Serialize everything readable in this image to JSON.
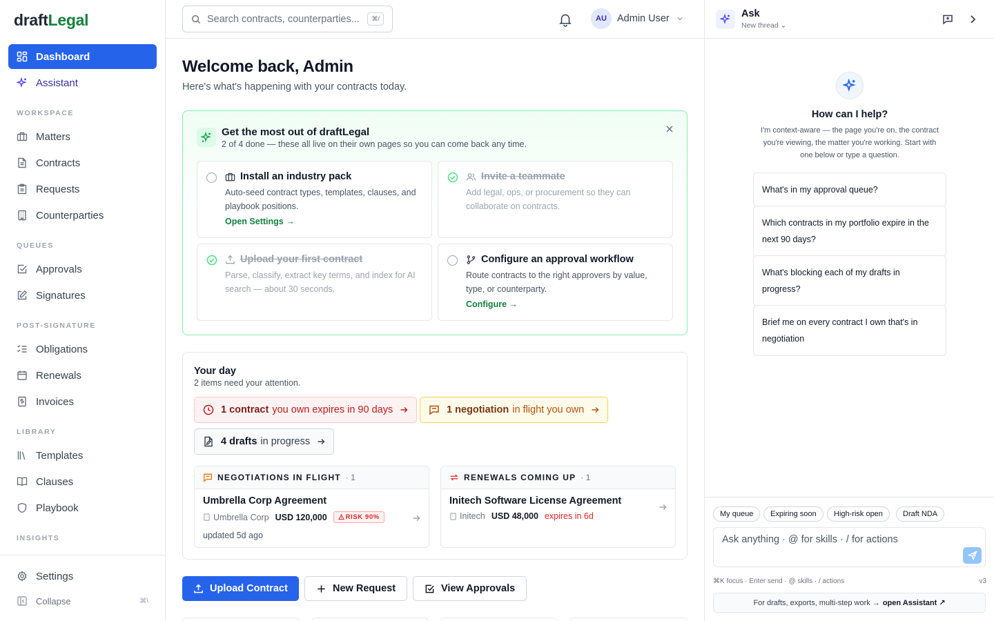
{
  "brand": {
    "part1": "draft",
    "part2": "Legal",
    "accent": "#15803d"
  },
  "sidebar": {
    "top": [
      {
        "label": "Dashboard",
        "icon": "dashboard-icon",
        "active": true
      },
      {
        "label": "Assistant",
        "icon": "sparkle-icon"
      }
    ],
    "sections": [
      {
        "title": "WORKSPACE",
        "items": [
          {
            "label": "Matters",
            "icon": "briefcase-icon"
          },
          {
            "label": "Contracts",
            "icon": "document-icon"
          },
          {
            "label": "Requests",
            "icon": "clipboard-icon"
          },
          {
            "label": "Counterparties",
            "icon": "building-icon"
          }
        ]
      },
      {
        "title": "QUEUES",
        "items": [
          {
            "label": "Approvals",
            "icon": "check-square-icon"
          },
          {
            "label": "Signatures",
            "icon": "pen-square-icon"
          }
        ]
      },
      {
        "title": "POST-SIGNATURE",
        "items": [
          {
            "label": "Obligations",
            "icon": "list-check-icon"
          },
          {
            "label": "Renewals",
            "icon": "calendar-icon"
          },
          {
            "label": "Invoices",
            "icon": "receipt-icon"
          }
        ]
      },
      {
        "title": "LIBRARY",
        "items": [
          {
            "label": "Templates",
            "icon": "library-icon"
          },
          {
            "label": "Clauses",
            "icon": "book-icon"
          },
          {
            "label": "Playbook",
            "icon": "shield-icon"
          }
        ]
      },
      {
        "title": "INSIGHTS",
        "items": []
      }
    ],
    "settings": "Settings",
    "collapse": "Collapse",
    "collapse_kbd": "⌘\\"
  },
  "header": {
    "search_placeholder": "Search contracts, counterparties...",
    "search_kbd": "⌘/",
    "avatar": "AU",
    "user": "Admin User"
  },
  "main": {
    "welcome": "Welcome back, Admin",
    "welcome_sub": "Here's what's happening with your contracts today.",
    "onboarding": {
      "title": "Get the most out of draftLegal",
      "subtitle": "2 of 4 done — these all live on their own pages so you can come back any time.",
      "cards": [
        {
          "title": "Install an industry pack",
          "desc": "Auto-seed contract types, templates, clauses, and playbook positions.",
          "link": "Open Settings →",
          "done": false
        },
        {
          "title": "Invite a teammate",
          "desc": "Add legal, ops, or procurement so they can collaborate on contracts.",
          "link": "",
          "done": true
        },
        {
          "title": "Upload your first contract",
          "desc": "Parse, classify, extract key terms, and index for AI search — about 30 seconds.",
          "link": "",
          "done": true
        },
        {
          "title": "Configure an approval workflow",
          "desc": "Route contracts to the right approvers by value, type, or counterparty.",
          "link": "Configure →",
          "done": false
        }
      ]
    },
    "day": {
      "title": "Your day",
      "subtitle": "2 items need your attention.",
      "chips": [
        {
          "bold": "1 contract",
          "rest": "you own expires in 90 days"
        },
        {
          "bold": "1 negotiation",
          "rest": "in flight you own"
        },
        {
          "bold": "4 drafts",
          "rest": "in progress"
        }
      ],
      "negotiations": {
        "title": "NEGOTIATIONS IN FLIGHT",
        "count": "· 1",
        "item": {
          "name": "Umbrella Corp Agreement",
          "party": "Umbrella Corp",
          "amount": "USD 120,000",
          "risk": "RISK 90%",
          "updated": "updated 5d ago"
        }
      },
      "renewals": {
        "title": "RENEWALS COMING UP",
        "count": "· 1",
        "item": {
          "name": "Initech Software License Agreement",
          "party": "Initech",
          "amount": "USD 48,000",
          "expires": "expires in 6d"
        }
      }
    },
    "actions": {
      "upload": "Upload Contract",
      "new_request": "New Request",
      "view_approvals": "View Approvals"
    }
  },
  "assistant": {
    "title": "Ask",
    "thread": "New thread",
    "help_title": "How can I help?",
    "help_sub": "I'm context-aware — the page you're on, the contract you're viewing, the matter you're working. Start with one below or type a question.",
    "suggestions": [
      "What's in my approval queue?",
      "Which contracts in my portfolio expire in the next 90 days?",
      "What's blocking each of my drafts in progress?",
      "Brief me on every contract I own that's in negotiation"
    ],
    "quick": [
      "My queue",
      "Expiring soon",
      "High-risk open",
      "Draft NDA"
    ],
    "placeholder": "Ask anything · @ for skills · / for actions",
    "hint": "⌘K focus · Enter send · @ skills · / actions",
    "version": "v3",
    "footer": "For drafts, exports, multi-step work →",
    "footer_link": "open Assistant ↗"
  }
}
